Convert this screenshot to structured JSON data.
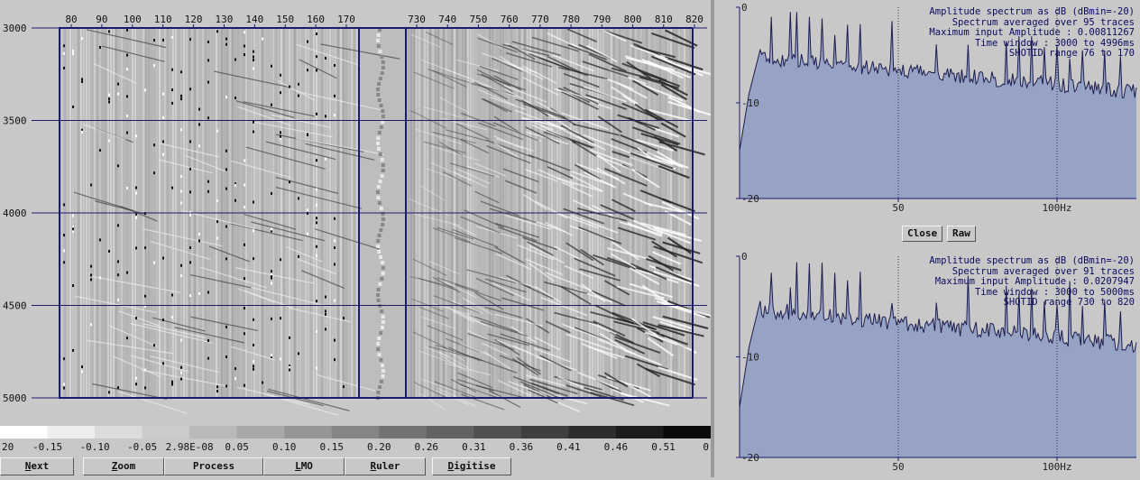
{
  "seismic": {
    "time_labels": [
      "3000",
      "3500",
      "4000",
      "4500",
      "5000"
    ],
    "left_traces": [
      "80",
      "90",
      "100",
      "110",
      "120",
      "130",
      "140",
      "150",
      "160",
      "170"
    ],
    "right_traces": [
      "730",
      "740",
      "750",
      "760",
      "770",
      "780",
      "790",
      "800",
      "810",
      "820"
    ],
    "grid_color": "#1a1a6e"
  },
  "scale": {
    "labels": [
      "20",
      "-0.15",
      "-0.10",
      "-0.05",
      "2.98E-08",
      "0.05",
      "0.10",
      "0.15",
      "0.20",
      "0.26",
      "0.31",
      "0.36",
      "0.41",
      "0.46",
      "0.51",
      "0"
    ]
  },
  "buttons": [
    {
      "underline": "N",
      "rest": "ext"
    },
    {
      "underline": "Z",
      "rest": "oom"
    },
    {
      "underline": "",
      "rest": "Process"
    },
    {
      "underline": "L",
      "rest": "MO"
    },
    {
      "underline": "R",
      "rest": "uler"
    },
    {
      "underline": "D",
      "rest": "igitise"
    }
  ],
  "mid_controls": {
    "close": "Close",
    "raw": "Raw"
  },
  "spectrum_top": {
    "info": [
      "Amplitude spectrum as dB (dBmin=-20)",
      "Spectrum averaged over 95 traces",
      "Maximum input Amplitude : 0.00811267",
      "Time window : 3000 to 4996ms",
      "SHOTID range 76 to 170"
    ],
    "y_labels": [
      "0",
      "-10",
      "-20"
    ],
    "x_labels": [
      "50",
      "100Hz"
    ]
  },
  "spectrum_bottom": {
    "info": [
      "Amplitude spectrum as dB (dBmin=-20)",
      "Spectrum averaged over 91 traces",
      "Maximum input Amplitude : 0.0207947",
      "Time window : 3000 to 5000ms",
      "SHOTID range 730 to 820"
    ],
    "y_labels": [
      "0",
      "-10",
      "-20"
    ],
    "x_labels": [
      "50",
      "100Hz"
    ]
  },
  "colors": {
    "spectrum_fill": "#97a3c4",
    "spectrum_line": "#1c1c50",
    "axis": "#1a1a6e"
  }
}
